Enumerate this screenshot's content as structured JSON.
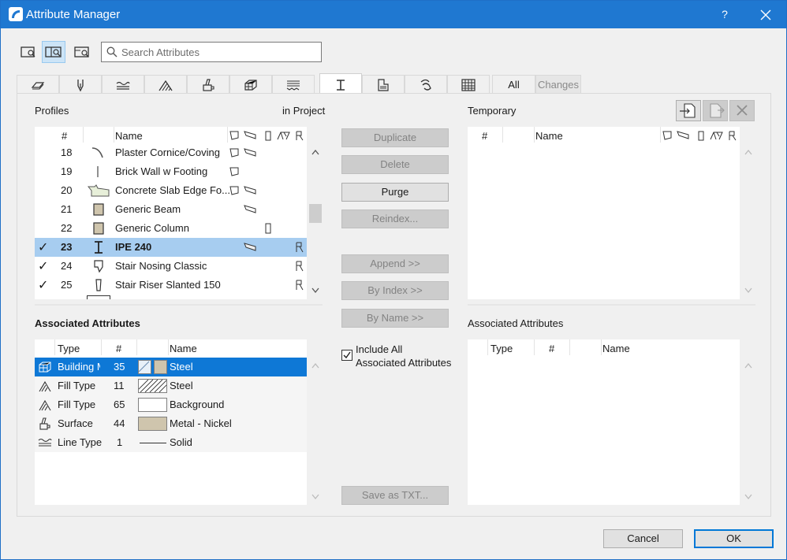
{
  "window": {
    "title": "Attribute Manager",
    "help_label": "?"
  },
  "search": {
    "placeholder": "Search Attributes",
    "value": ""
  },
  "tabs": {
    "all_label": "All",
    "changes_label": "Changes",
    "icons": [
      "layer-icon",
      "pen-icon",
      "line-type-icon",
      "fill-icon",
      "surface-icon",
      "building-material-icon",
      "composite-icon",
      "profile-icon",
      "zone-icon",
      "mep-icon",
      "markup-icon"
    ]
  },
  "left": {
    "title": "Profiles",
    "scope": "in Project",
    "columns": {
      "num": "#",
      "name": "Name"
    },
    "rows": [
      {
        "num": "18",
        "name": "Plaster Cornice/Coving",
        "check": ""
      },
      {
        "num": "19",
        "name": "Brick Wall w Footing",
        "check": ""
      },
      {
        "num": "20",
        "name": "Concrete Slab Edge Fo...",
        "check": ""
      },
      {
        "num": "21",
        "name": "Generic Beam",
        "check": ""
      },
      {
        "num": "22",
        "name": "Generic Column",
        "check": ""
      },
      {
        "num": "23",
        "name": "IPE 240",
        "check": "✓"
      },
      {
        "num": "24",
        "name": "Stair Nosing Classic",
        "check": "✓"
      },
      {
        "num": "25",
        "name": "Stair Riser Slanted 150",
        "check": "✓"
      }
    ]
  },
  "actions": {
    "duplicate": "Duplicate",
    "delete": "Delete",
    "purge": "Purge",
    "reindex": "Reindex...",
    "append": "Append >>",
    "by_index": "By Index >>",
    "by_name": "By Name >>",
    "include_all": "Include All",
    "include_all_2": "Associated Attributes",
    "include_all_checked": true,
    "save_txt": "Save as TXT..."
  },
  "right": {
    "title": "Temporary",
    "columns": {
      "num": "#",
      "name": "Name"
    }
  },
  "assoc_left": {
    "title": "Associated Attributes",
    "columns": {
      "type": "Type",
      "num": "#",
      "name": "Name"
    },
    "rows": [
      {
        "type": "Building M",
        "num": "35",
        "name": "Steel"
      },
      {
        "type": "Fill Type",
        "num": "11",
        "name": "Steel"
      },
      {
        "type": "Fill Type",
        "num": "65",
        "name": "Background"
      },
      {
        "type": "Surface",
        "num": "44",
        "name": "Metal - Nickel"
      },
      {
        "type": "Line Type",
        "num": "1",
        "name": "Solid"
      }
    ]
  },
  "assoc_right": {
    "title": "Associated Attributes",
    "columns": {
      "type": "Type",
      "num": "#",
      "name": "Name"
    }
  },
  "footer": {
    "cancel": "Cancel",
    "ok": "OK"
  },
  "colors": {
    "titlebar": "#1f78d1",
    "selection": "#0e78d6",
    "row_highlight": "#a7cdf0",
    "swatch_tan": "#cfc5ad"
  }
}
